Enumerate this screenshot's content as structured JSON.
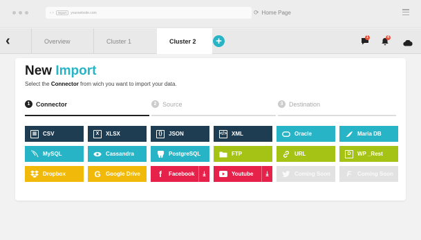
{
  "browser": {
    "url": "yourwebsite.com",
    "chip": "import",
    "home_label": "Home Page"
  },
  "tabs": [
    {
      "label": "Overview"
    },
    {
      "label": "Cluster 1"
    },
    {
      "label": "Cluster 2"
    }
  ],
  "header": {
    "add_label": "+",
    "chat_badge": "1",
    "bell_badge": "4"
  },
  "card": {
    "title_main": "New",
    "title_accent": "Import",
    "subtitle_pre": "Select the",
    "subtitle_bold": "Connector",
    "subtitle_post": "from wich you want to import your data."
  },
  "steps": [
    {
      "num": "1",
      "label": "Connector",
      "active": true
    },
    {
      "num": "2",
      "label": "Source",
      "active": false
    },
    {
      "num": "3",
      "label": "Destination",
      "active": false
    }
  ],
  "connectors": [
    {
      "label": "CSV",
      "icon": "table-icon",
      "color": "#1e3d53"
    },
    {
      "label": "XLSX",
      "icon": "excel-icon",
      "color": "#1e3d53"
    },
    {
      "label": "JSON",
      "icon": "json-icon",
      "color": "#1e3d53"
    },
    {
      "label": "XML",
      "icon": "xml-icon",
      "color": "#1e3d53"
    },
    {
      "label": "Oracle",
      "icon": "oracle-icon",
      "color": "#27b4c6"
    },
    {
      "label": "Maria DB",
      "icon": "seal-icon",
      "color": "#27b4c6"
    },
    {
      "label": "MySQL",
      "icon": "dolphin-icon",
      "color": "#27b4c6"
    },
    {
      "label": "Cassandra",
      "icon": "eye-icon",
      "color": "#27b4c6"
    },
    {
      "label": "PostgreSQL",
      "icon": "elephant-icon",
      "color": "#27b4c6"
    },
    {
      "label": "FTP",
      "icon": "folder-icon",
      "color": "#a5c315"
    },
    {
      "label": "URL",
      "icon": "link-icon",
      "color": "#a5c315"
    },
    {
      "label": "WP _Rest",
      "icon": "wp-icon",
      "color": "#a5c315"
    },
    {
      "label": "Dropbox",
      "icon": "dropbox-icon",
      "color": "#f1b90a"
    },
    {
      "label": "Google Drive",
      "icon": "google-icon",
      "color": "#f1b90a"
    },
    {
      "label": "Facebook",
      "icon": "facebook-icon",
      "color": "#e7224a",
      "download": true
    },
    {
      "label": "Youtube",
      "icon": "youtube-icon",
      "color": "#e7224a",
      "download": true
    },
    {
      "label": "Coming Soon",
      "icon": "twitter-icon",
      "color": "#e2e2e2"
    },
    {
      "label": "Coming Soon",
      "icon": "flickr-icon",
      "color": "#e2e2e2"
    }
  ]
}
